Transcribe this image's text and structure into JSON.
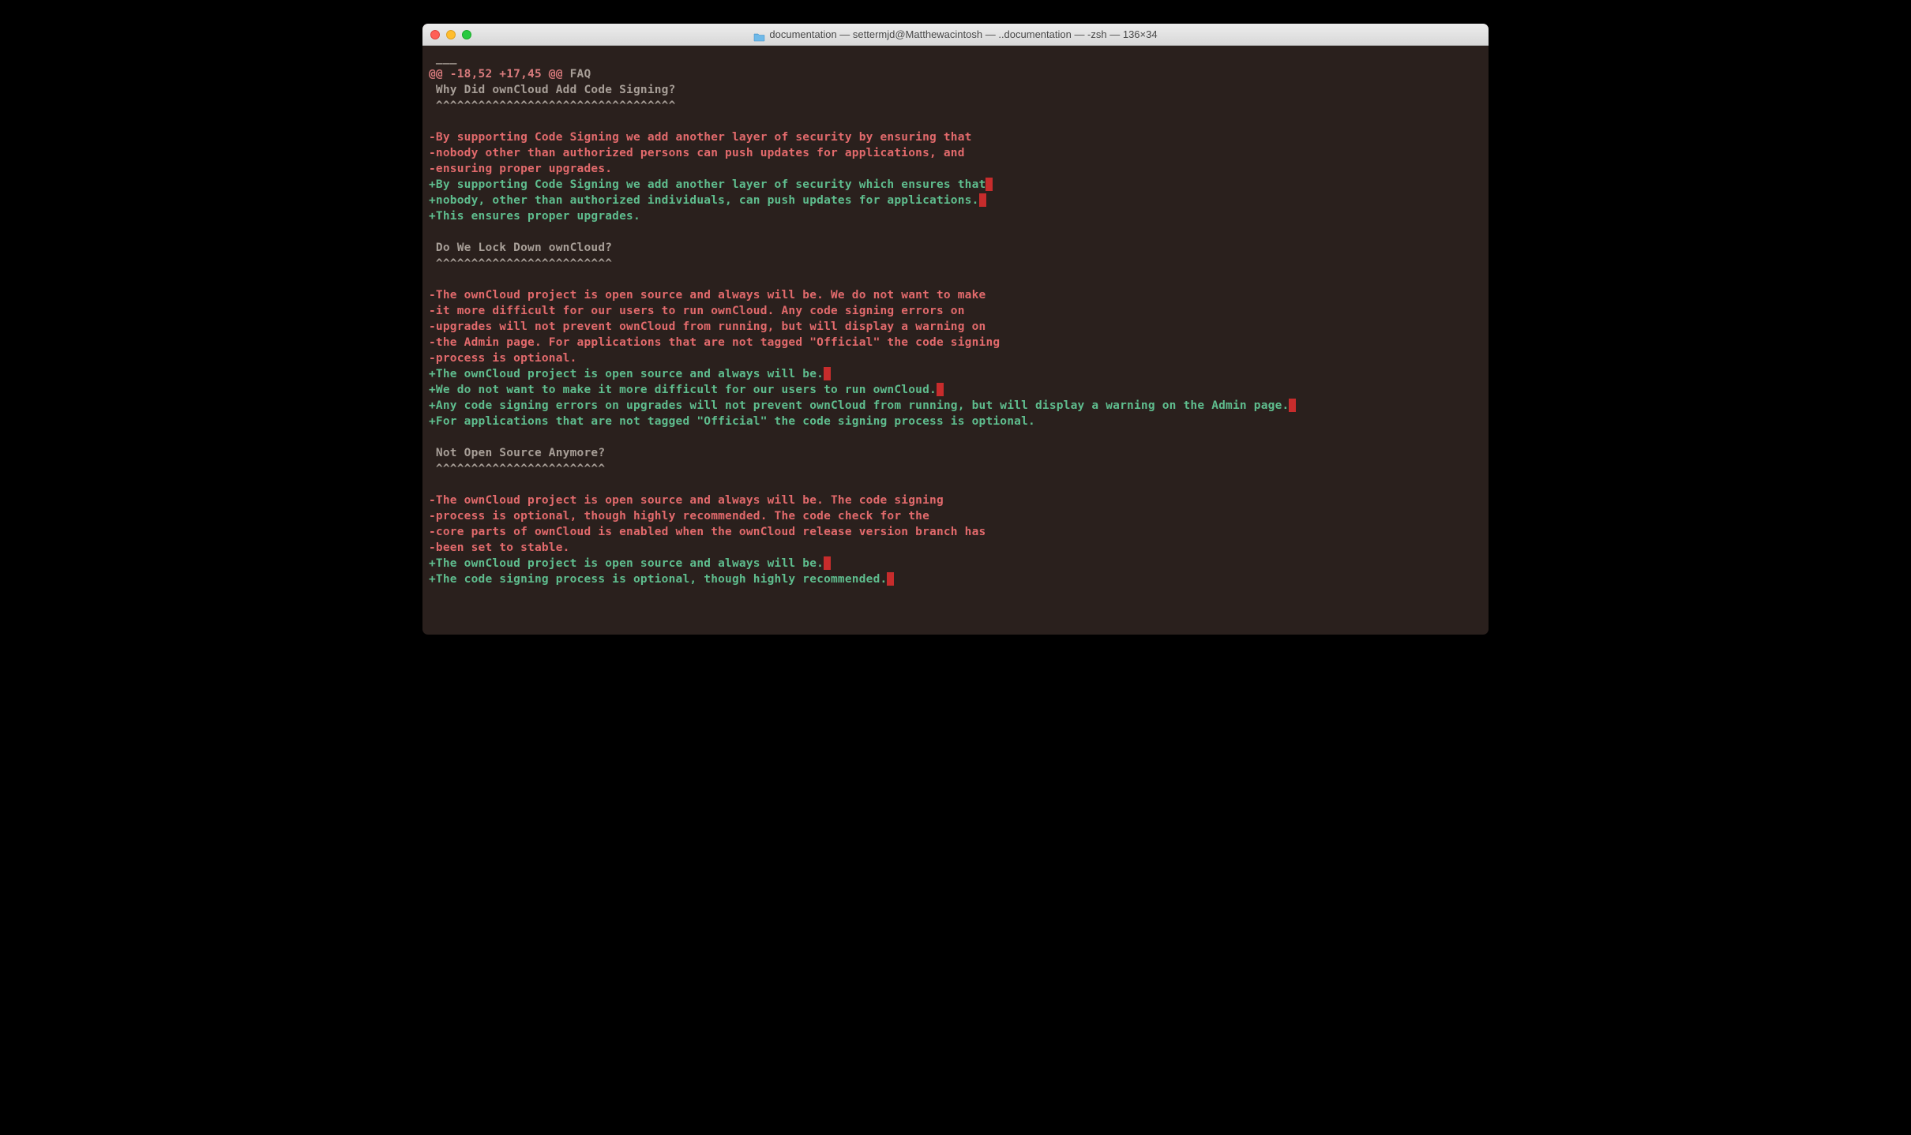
{
  "window": {
    "title": "documentation — settermjd@Matthewacintosh — ..documentation — -zsh — 136×34"
  },
  "diff": {
    "hunk_marker": "@@ -18,52 +17,45 @@",
    "hunk_label": " FAQ",
    "lines": [
      {
        "type": "context",
        "text": " ___"
      },
      {
        "type": "hunk"
      },
      {
        "type": "context",
        "text": " Why Did ownCloud Add Code Signing?"
      },
      {
        "type": "context",
        "text": " ^^^^^^^^^^^^^^^^^^^^^^^^^^^^^^^^^^"
      },
      {
        "type": "blank",
        "text": ""
      },
      {
        "type": "removed",
        "text": "-By supporting Code Signing we add another layer of security by ensuring that"
      },
      {
        "type": "removed",
        "text": "-nobody other than authorized persons can push updates for applications, and"
      },
      {
        "type": "removed",
        "text": "-ensuring proper upgrades."
      },
      {
        "type": "added",
        "text": "+By supporting Code Signing we add another layer of security which ensures that",
        "trailing_ws": true
      },
      {
        "type": "added",
        "text": "+nobody, other than authorized individuals, can push updates for applications.",
        "trailing_ws": true
      },
      {
        "type": "added",
        "text": "+This ensures proper upgrades."
      },
      {
        "type": "blank",
        "text": ""
      },
      {
        "type": "context",
        "text": " Do We Lock Down ownCloud?"
      },
      {
        "type": "context",
        "text": " ^^^^^^^^^^^^^^^^^^^^^^^^^"
      },
      {
        "type": "blank",
        "text": ""
      },
      {
        "type": "removed",
        "text": "-The ownCloud project is open source and always will be. We do not want to make"
      },
      {
        "type": "removed",
        "text": "-it more difficult for our users to run ownCloud. Any code signing errors on"
      },
      {
        "type": "removed",
        "text": "-upgrades will not prevent ownCloud from running, but will display a warning on"
      },
      {
        "type": "removed",
        "text": "-the Admin page. For applications that are not tagged \"Official\" the code signing"
      },
      {
        "type": "removed",
        "text": "-process is optional."
      },
      {
        "type": "added",
        "text": "+The ownCloud project is open source and always will be.",
        "trailing_ws": true
      },
      {
        "type": "added",
        "text": "+We do not want to make it more difficult for our users to run ownCloud.",
        "trailing_ws": true
      },
      {
        "type": "added",
        "text": "+Any code signing errors on upgrades will not prevent ownCloud from running, but will display a warning on the Admin page.",
        "trailing_ws": true
      },
      {
        "type": "added",
        "text": "+For applications that are not tagged \"Official\" the code signing process is optional."
      },
      {
        "type": "blank",
        "text": ""
      },
      {
        "type": "context",
        "text": " Not Open Source Anymore?"
      },
      {
        "type": "context",
        "text": " ^^^^^^^^^^^^^^^^^^^^^^^^"
      },
      {
        "type": "blank",
        "text": ""
      },
      {
        "type": "removed",
        "text": "-The ownCloud project is open source and always will be. The code signing"
      },
      {
        "type": "removed",
        "text": "-process is optional, though highly recommended. The code check for the"
      },
      {
        "type": "removed",
        "text": "-core parts of ownCloud is enabled when the ownCloud release version branch has"
      },
      {
        "type": "removed",
        "text": "-been set to stable."
      },
      {
        "type": "added",
        "text": "+The ownCloud project is open source and always will be.",
        "trailing_ws": true
      },
      {
        "type": "added",
        "text": "+The code signing process is optional, though highly recommended.",
        "trailing_ws": true
      }
    ]
  }
}
